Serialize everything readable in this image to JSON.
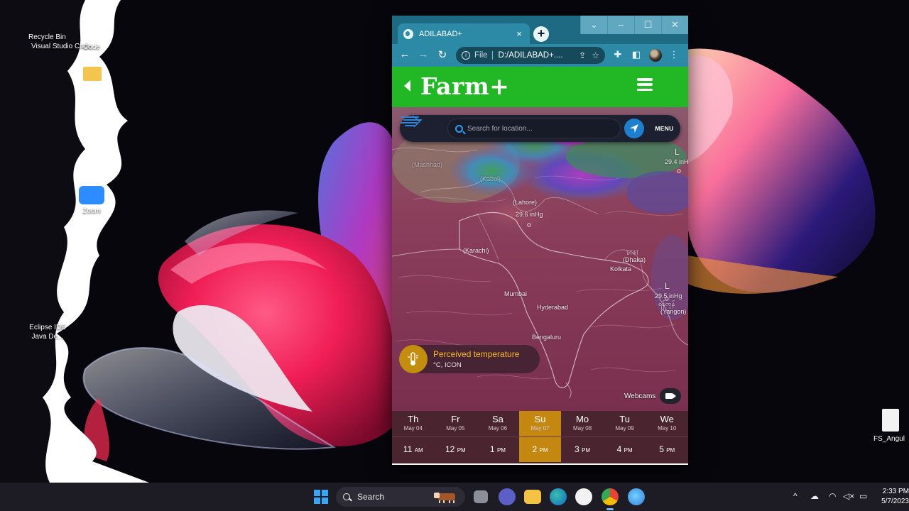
{
  "desktop": {
    "icons": [
      {
        "label": "Recycle Bin",
        "label2": "Visual Studio Code"
      },
      {
        "label": "Code"
      },
      {
        "label": "Zoom"
      },
      {
        "label": "Eclipse IDE"
      },
      {
        "label": "Java De..."
      },
      {
        "label": "FS_Angul"
      }
    ]
  },
  "browser": {
    "tab_title": "ADILABAD+",
    "tab_close": "×",
    "new_tab": "+",
    "window_controls": {
      "dropdown": "⌄",
      "minimize": "–",
      "maximize": "☐",
      "close": "✕"
    },
    "nav": {
      "back": "←",
      "forward": "→",
      "reload": "↻"
    },
    "omnibox": {
      "info": "i",
      "scheme": "File",
      "url": "D:/ADILABAD+...."
    },
    "toolbar_icons": [
      "share-icon",
      "star-icon",
      "extensions-icon",
      "sidepanel-icon",
      "avatar",
      "more-icon"
    ]
  },
  "page": {
    "brand": "Farm+",
    "search": {
      "placeholder": "Search for location...",
      "menu_label": "MENU"
    },
    "map_labels": {
      "mashhad": "(Mashhad)",
      "kabul": "(Kabul)",
      "lahore": "(Lahore)",
      "pressure_lahore": "29.6 inHg",
      "karachi": "(Karachi)",
      "dhaka_local": "ঢাকা",
      "dhaka": "(Dhaka)",
      "kolkata": "Kolkata",
      "mumbai": "Mumbai",
      "hyderabad": "Hyderabad",
      "bengaluru": "Bengaluru",
      "yangon": "(Yangon)",
      "yangon_local": "ရန်ကုန်",
      "pressure_east": "29.5 inHg",
      "pressure_ne": "29.4 inH",
      "low_ne": "L",
      "low_east": "L"
    },
    "perceived": {
      "title": "Perceived temperature",
      "subtitle": "°C, ICON"
    },
    "webcams": "Webcams",
    "timeline": {
      "days": [
        {
          "name": "Th",
          "date": "May 04"
        },
        {
          "name": "Fr",
          "date": "May 05"
        },
        {
          "name": "Sa",
          "date": "May 06"
        },
        {
          "name": "Su",
          "date": "May 07"
        },
        {
          "name": "Mo",
          "date": "May 08"
        },
        {
          "name": "Tu",
          "date": "May 09"
        },
        {
          "name": "We",
          "date": "May 10"
        }
      ],
      "hours": [
        {
          "h": "11",
          "ap": "AM"
        },
        {
          "h": "12",
          "ap": "PM"
        },
        {
          "h": "1",
          "ap": "PM"
        },
        {
          "h": "2",
          "ap": "PM"
        },
        {
          "h": "3",
          "ap": "PM"
        },
        {
          "h": "4",
          "ap": "PM"
        },
        {
          "h": "5",
          "ap": "PM"
        }
      ],
      "selected_index": 3
    }
  },
  "taskbar": {
    "search_label": "Search",
    "tray": {
      "chevron": "^",
      "time": "2:33 PM",
      "date": "5/7/2023"
    }
  },
  "colors": {
    "farm_green": "#21b725",
    "selected_day": "#c48810",
    "browser_frame": "#2c8aa7",
    "accent_blue": "#1f7fcf"
  }
}
